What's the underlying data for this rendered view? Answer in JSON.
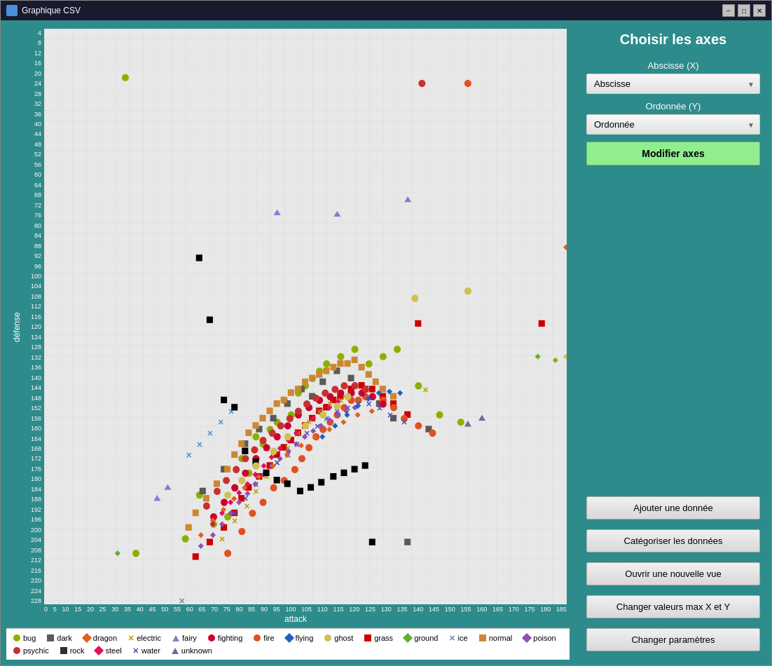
{
  "window": {
    "title": "Graphique CSV"
  },
  "titlebar": {
    "minimize": "−",
    "maximize": "□",
    "close": "✕"
  },
  "sidebar": {
    "title": "Choisir les axes",
    "abscisse_label": "Abscisse (X)",
    "abscisse_placeholder": "Abscisse",
    "ordonnee_label": "Ordonnée (Y)",
    "ordonnee_placeholder": "Ordonnée",
    "btn_modifier": "Modifier axes",
    "btn_ajouter": "Ajouter une donnée",
    "btn_categoriser": "Catégoriser les données",
    "btn_nouvelle_vue": "Ouvrir une nouvelle vue",
    "btn_changer_max": "Changer valeurs max X et Y",
    "btn_parametres": "Changer paramètres"
  },
  "chart": {
    "x_label": "attack",
    "y_label": "défense",
    "y_ticks": [
      "228",
      "224",
      "220",
      "216",
      "212",
      "208",
      "204",
      "200",
      "196",
      "192",
      "188",
      "184",
      "180",
      "176",
      "172",
      "168",
      "164",
      "160",
      "156",
      "152",
      "148",
      "144",
      "140",
      "136",
      "132",
      "128",
      "124",
      "120",
      "116",
      "112",
      "108",
      "104",
      "100",
      "96",
      "92",
      "88",
      "84",
      "80",
      "76",
      "72",
      "68",
      "64",
      "60",
      "56",
      "52",
      "48",
      "44",
      "40",
      "36",
      "32",
      "28",
      "24",
      "20",
      "16",
      "12",
      "8",
      "4"
    ],
    "x_ticks": [
      "0",
      "5",
      "10",
      "15",
      "20",
      "25",
      "30",
      "35",
      "40",
      "45",
      "50",
      "55",
      "60",
      "65",
      "70",
      "75",
      "80",
      "85",
      "90",
      "95",
      "100",
      "105",
      "110",
      "115",
      "120",
      "125",
      "130",
      "135",
      "140",
      "145",
      "150",
      "155",
      "160",
      "165",
      "170",
      "175",
      "180",
      "185"
    ]
  },
  "legend": [
    {
      "name": "bug",
      "shape": "dot",
      "color": "#8db000"
    },
    {
      "name": "dark",
      "shape": "square",
      "color": "#5a5a5a"
    },
    {
      "name": "dragon",
      "shape": "diamond",
      "color": "#e06020"
    },
    {
      "name": "electric",
      "shape": "cross",
      "color": "#b8a000"
    },
    {
      "name": "fairy",
      "shape": "triangle",
      "color": "#8080d0"
    },
    {
      "name": "fighting",
      "shape": "dot",
      "color": "#cc0000"
    },
    {
      "name": "fire",
      "shape": "dot",
      "color": "#e05020"
    },
    {
      "name": "flying",
      "shape": "diamond",
      "color": "#2060c0"
    },
    {
      "name": "ghost",
      "shape": "dot",
      "color": "#d0c050"
    },
    {
      "name": "grass",
      "shape": "square",
      "color": "#cc0000"
    },
    {
      "name": "ground",
      "shape": "diamond",
      "color": "#60b030"
    },
    {
      "name": "ice",
      "shape": "cross",
      "color": "#6090c0"
    },
    {
      "name": "normal",
      "shape": "square",
      "color": "#cc8830"
    },
    {
      "name": "poison",
      "shape": "diamond",
      "color": "#9050b0"
    },
    {
      "name": "psychic",
      "shape": "dot",
      "color": "#c83030"
    },
    {
      "name": "rock",
      "shape": "square",
      "color": "#303030"
    },
    {
      "name": "steel",
      "shape": "diamond",
      "color": "#e01060"
    },
    {
      "name": "water",
      "shape": "cross",
      "color": "#5050c0"
    },
    {
      "name": "unknown",
      "shape": "triangle",
      "color": "#8060a0"
    }
  ]
}
